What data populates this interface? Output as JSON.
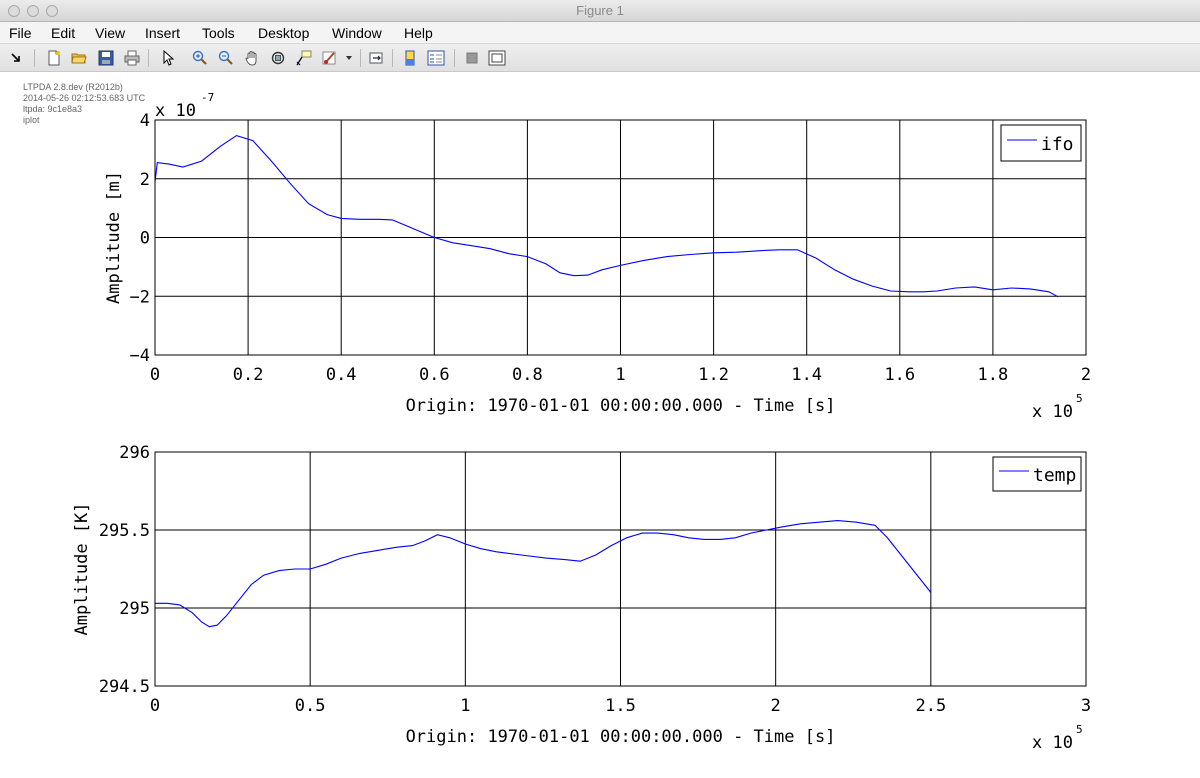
{
  "window": {
    "title": "Figure 1"
  },
  "menu": [
    "File",
    "Edit",
    "View",
    "Insert",
    "Tools",
    "Desktop",
    "Window",
    "Help"
  ],
  "toolbar": {
    "icons": [
      "dock-arrow-icon",
      "new-figure-icon",
      "open-file-icon",
      "save-icon",
      "print-icon",
      "select-pointer-icon",
      "zoom-in-icon",
      "zoom-out-icon",
      "pan-hand-icon",
      "rotate-3d-icon",
      "data-cursor-icon",
      "brush-icon",
      "brush-dropdown-icon",
      "link-plot-icon",
      "colorbar-icon",
      "legend-icon",
      "hide-plot-tools-icon",
      "show-plot-tools-icon"
    ]
  },
  "stamp": {
    "line1": "LTPDA 2.8.dev (R2012b)",
    "line2": "2014-05-26 02:12:53.683 UTC",
    "line3": "ltpda: 9c1e8a3",
    "line4": "iplot"
  },
  "chart_data": [
    {
      "type": "line",
      "series": [
        {
          "name": "ifo",
          "color": "#0000ff",
          "x": [
            0,
            500,
            3000,
            6000,
            10000,
            14000,
            17500,
            21000,
            25000,
            29000,
            33000,
            37000,
            40000,
            44000,
            48000,
            51000,
            54000,
            57000,
            60000,
            64000,
            68000,
            72000,
            76000,
            80000,
            84000,
            87000,
            90000,
            93000,
            96000,
            100000,
            105000,
            110000,
            115000,
            120000,
            125000,
            130000,
            134000,
            138000,
            142000,
            146000,
            150000,
            154000,
            158000,
            162000,
            165000,
            168000,
            172000,
            176000,
            180000,
            184000,
            188000,
            192000,
            194000
          ],
          "y": [
            1.9e-07,
            2.55e-07,
            2.5e-07,
            2.4e-07,
            2.6e-07,
            3.1e-07,
            3.47e-07,
            3.3e-07,
            2.6e-07,
            1.85e-07,
            1.15e-07,
            7.8e-08,
            6.5e-08,
            6.2e-08,
            6.2e-08,
            6e-08,
            4e-08,
            2e-08,
            0.0,
            -1.8e-08,
            -2.8e-08,
            -3.8e-08,
            -5.5e-08,
            -6.5e-08,
            -9e-08,
            -1.2e-07,
            -1.3e-07,
            -1.28e-07,
            -1.1e-07,
            -9.5e-08,
            -7.8e-08,
            -6.5e-08,
            -5.8e-08,
            -5.2e-08,
            -5e-08,
            -4.5e-08,
            -4.2e-08,
            -4.2e-08,
            -7e-08,
            -1.1e-07,
            -1.42e-07,
            -1.65e-07,
            -1.82e-07,
            -1.85e-07,
            -1.85e-07,
            -1.82e-07,
            -1.72e-07,
            -1.68e-07,
            -1.78e-07,
            -1.72e-07,
            -1.75e-07,
            -1.85e-07,
            -2.02e-07
          ]
        }
      ],
      "xlabel": "Origin: 1970-01-01 00:00:00.000 - Time  [s]",
      "ylabel": "Amplitude  [m]",
      "xlim": [
        0,
        200000
      ],
      "ylim": [
        -4e-07,
        4e-07
      ],
      "x_ticks": [
        "0",
        "0.2",
        "0.4",
        "0.6",
        "0.8",
        "1",
        "1.2",
        "1.4",
        "1.6",
        "1.8",
        "2"
      ],
      "y_ticks": [
        "4",
        "2",
        "0",
        "−2",
        "−4"
      ],
      "x_exponent_base": "x 10",
      "x_exponent_power": "5",
      "y_exponent_base": "x 10",
      "y_exponent_power": "-7",
      "grid": true,
      "legend": "top-right"
    },
    {
      "type": "line",
      "series": [
        {
          "name": "temp",
          "color": "#0000ff",
          "x": [
            0,
            4000,
            8000,
            12000,
            15000,
            17500,
            20000,
            23000,
            27000,
            31000,
            35000,
            40000,
            45000,
            50000,
            55000,
            60000,
            66000,
            72000,
            78000,
            83000,
            87000,
            91000,
            95000,
            100000,
            105000,
            110000,
            118000,
            126000,
            132000,
            137000,
            142000,
            147000,
            152000,
            157000,
            162000,
            167000,
            172000,
            177000,
            182000,
            187000,
            192000,
            197000,
            202000,
            208000,
            214000,
            220000,
            226000,
            232000,
            236000,
            240000,
            244000,
            248000,
            250000
          ],
          "y": [
            295.03,
            295.03,
            295.02,
            294.97,
            294.91,
            294.88,
            294.89,
            294.95,
            295.05,
            295.15,
            295.21,
            295.24,
            295.25,
            295.25,
            295.28,
            295.32,
            295.35,
            295.37,
            295.39,
            295.4,
            295.43,
            295.47,
            295.45,
            295.41,
            295.38,
            295.36,
            295.34,
            295.32,
            295.31,
            295.3,
            295.34,
            295.4,
            295.45,
            295.48,
            295.48,
            295.47,
            295.45,
            295.44,
            295.44,
            295.45,
            295.48,
            295.5,
            295.52,
            295.54,
            295.55,
            295.56,
            295.55,
            295.53,
            295.45,
            295.35,
            295.25,
            295.15,
            295.1
          ]
        }
      ],
      "xlabel": "Origin: 1970-01-01 00:00:00.000 - Time  [s]",
      "ylabel": "Amplitude  [K]",
      "xlim": [
        0,
        300000
      ],
      "ylim": [
        294.5,
        296
      ],
      "x_ticks": [
        "0",
        "0.5",
        "1",
        "1.5",
        "2",
        "2.5",
        "3"
      ],
      "y_ticks": [
        "296",
        "295.5",
        "295",
        "294.5"
      ],
      "x_exponent_base": "x 10",
      "x_exponent_power": "5",
      "grid": true,
      "legend": "top-right"
    }
  ]
}
